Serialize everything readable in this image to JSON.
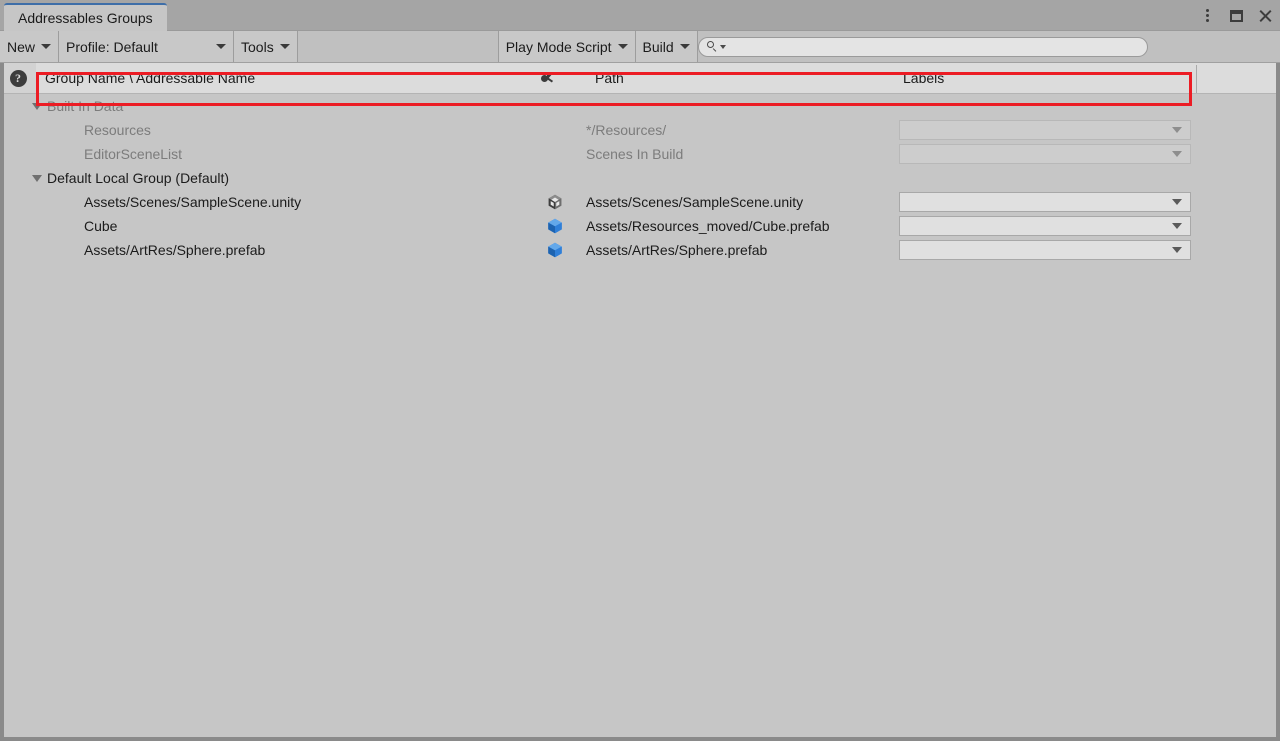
{
  "window": {
    "tab_title": "Addressables Groups",
    "controls": {
      "menu": "kebab-menu",
      "maximize": "maximize",
      "close": "close"
    }
  },
  "toolbar": {
    "new_label": "New",
    "profile_label": "Profile: Default",
    "tools_label": "Tools",
    "play_mode_script_label": "Play Mode Script",
    "build_label": "Build",
    "search": {
      "value": "",
      "placeholder": ""
    }
  },
  "columns": {
    "help": "?",
    "name": "Group Name \\ Addressable Name",
    "path": "Path",
    "labels": "Labels"
  },
  "colors": {
    "highlight": "#ec1c24",
    "tab_accent": "#3e6ea8",
    "window_bg": "#c6c6c6",
    "header_bg": "#dcdcdc",
    "prefab_icon": "#2f7fd8"
  },
  "tree": [
    {
      "name": "Built In Data",
      "indent": 0,
      "expanded": true,
      "dim": true,
      "has_arrow": true,
      "icon": "",
      "path": "",
      "label_dropdown": false
    },
    {
      "name": "Resources",
      "indent": 1,
      "expanded": false,
      "dim": true,
      "has_arrow": false,
      "icon": "",
      "path": "*/Resources/",
      "label_dropdown": true,
      "label_value": "",
      "label_disabled": true
    },
    {
      "name": "EditorSceneList",
      "indent": 1,
      "expanded": false,
      "dim": true,
      "has_arrow": false,
      "icon": "",
      "path": "Scenes In Build",
      "label_dropdown": true,
      "label_value": "",
      "label_disabled": true
    },
    {
      "name": "Default Local Group (Default)",
      "indent": 0,
      "expanded": true,
      "dim": false,
      "has_arrow": true,
      "icon": "",
      "path": "",
      "label_dropdown": false
    },
    {
      "name": "Assets/Scenes/SampleScene.unity",
      "indent": 1,
      "expanded": false,
      "dim": false,
      "has_arrow": false,
      "icon": "unity-scene-icon",
      "path": "Assets/Scenes/SampleScene.unity",
      "label_dropdown": true,
      "label_value": "",
      "label_disabled": false
    },
    {
      "name": "Cube",
      "indent": 1,
      "expanded": false,
      "dim": false,
      "has_arrow": false,
      "icon": "prefab-icon",
      "path": "Assets/Resources_moved/Cube.prefab",
      "label_dropdown": true,
      "label_value": "",
      "label_disabled": false
    },
    {
      "name": "Assets/ArtRes/Sphere.prefab",
      "indent": 1,
      "expanded": false,
      "dim": false,
      "has_arrow": false,
      "icon": "prefab-icon",
      "path": "Assets/ArtRes/Sphere.prefab",
      "label_dropdown": true,
      "label_value": "",
      "label_disabled": false
    }
  ]
}
